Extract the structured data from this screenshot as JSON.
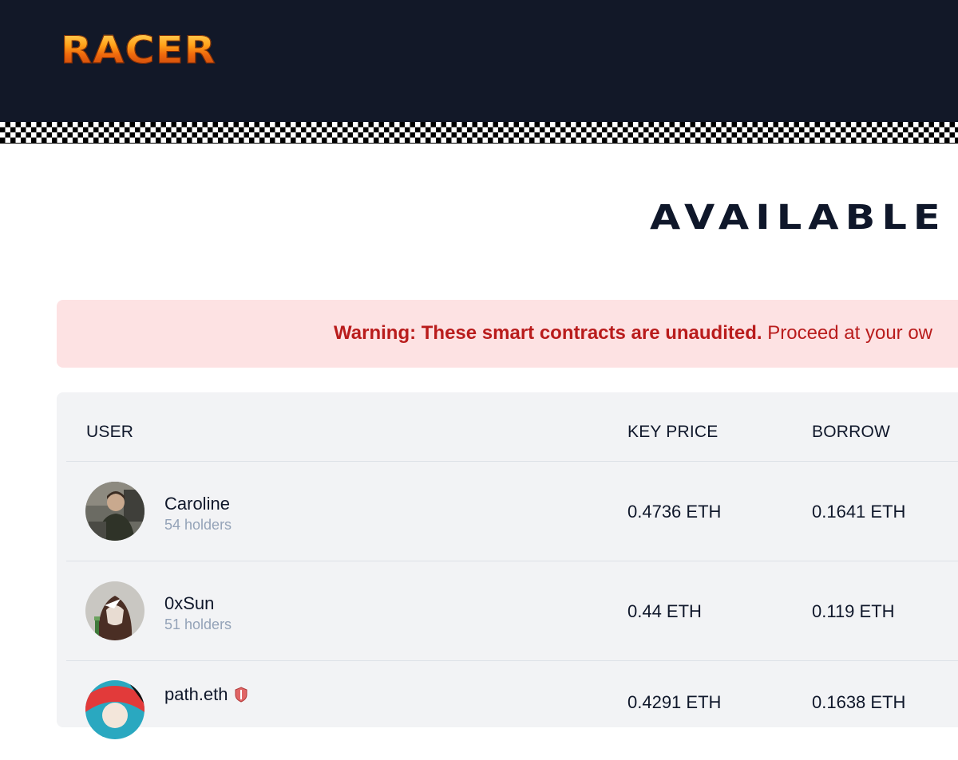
{
  "header": {
    "logo_text": "RACER"
  },
  "page": {
    "title": "AVAILABLE T"
  },
  "warning": {
    "bold": "Warning: These smart contracts are unaudited.",
    "rest": "Proceed at your ow"
  },
  "table": {
    "columns": {
      "user": "USER",
      "key_price": "KEY PRICE",
      "borrow": "BORROW"
    },
    "rows": [
      {
        "name": "Caroline",
        "holders": "54 holders",
        "key_price": "0.4736 ETH",
        "borrow": "0.1641 ETH"
      },
      {
        "name": "0xSun",
        "holders": "51 holders",
        "key_price": "0.44 ETH",
        "borrow": "0.119 ETH"
      },
      {
        "name": "path.eth",
        "holders": "",
        "key_price": "0.4291 ETH",
        "borrow": "0.1638 ETH"
      }
    ]
  },
  "colors": {
    "header_bg": "#121828",
    "warning_bg": "#fde2e3",
    "warning_text": "#b91c1c",
    "table_bg": "#f2f3f5",
    "muted_text": "#94a3b8"
  }
}
